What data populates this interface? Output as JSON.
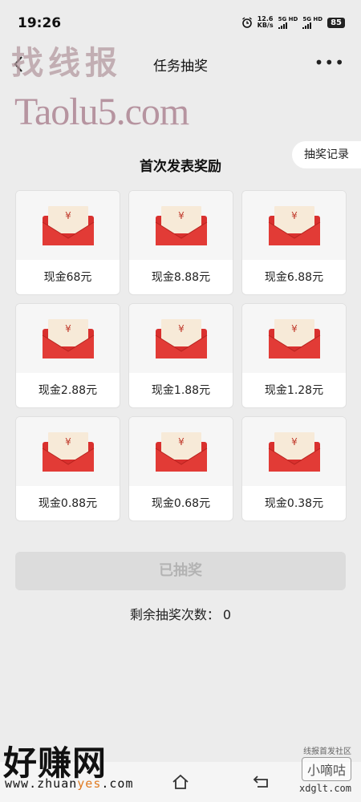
{
  "status_bar": {
    "time": "19:26",
    "net_speed_value": "12.6",
    "net_speed_unit": "KB/s",
    "sim1": "5G HD",
    "sim2": "5G HD",
    "battery": "85"
  },
  "header": {
    "title": "任务抽奖"
  },
  "watermarks": {
    "top_text": "找线报",
    "top_url": "Taolu5.com",
    "brand": "好赚网",
    "brand_url_pre": "www.zhuan",
    "brand_url_accent": "yes",
    "brand_url_post": ".com",
    "br_line1": "线报首发社区",
    "br_line2": "小嘀咕",
    "br_line3": "xdglt.com"
  },
  "record_button": "抽奖记录",
  "section_title": "首次发表奖励",
  "prizes": [
    {
      "label": "现金68元"
    },
    {
      "label": "现金8.88元"
    },
    {
      "label": "现金6.88元"
    },
    {
      "label": "现金2.88元"
    },
    {
      "label": "现金1.88元"
    },
    {
      "label": "现金1.28元"
    },
    {
      "label": "现金0.88元"
    },
    {
      "label": "现金0.68元"
    },
    {
      "label": "现金0.38元"
    }
  ],
  "envelope_symbol": "¥",
  "draw_button": "已抽奖",
  "remaining": {
    "label": "剩余抽奖次数：",
    "count": "0"
  },
  "colors": {
    "envelope_red": "#d9302e",
    "letter": "#f7ead8",
    "button_disabled": "#dcdcdc"
  }
}
